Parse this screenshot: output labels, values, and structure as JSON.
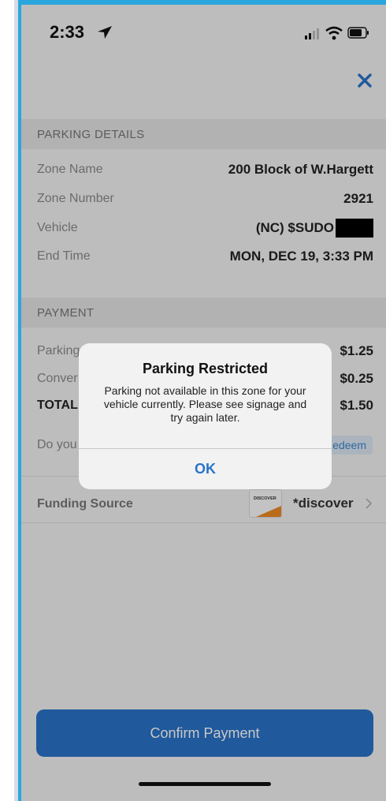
{
  "status_bar": {
    "time": "2:33",
    "icons": [
      "location-arrow-icon",
      "signal-icon",
      "wifi-icon",
      "battery-icon"
    ]
  },
  "header": {
    "close_icon": "close-icon"
  },
  "parking_details": {
    "title": "PARKING DETAILS",
    "zone_name_label": "Zone Name",
    "zone_name_value": "200 Block of W.Hargett",
    "zone_number_label": "Zone Number",
    "zone_number_value": "2921",
    "vehicle_label": "Vehicle",
    "vehicle_value": "(NC) $SUDO",
    "end_time_label": "End Time",
    "end_time_value": "MON, DEC 19, 3:33 PM"
  },
  "payment": {
    "title": "PAYMENT",
    "parking_label": "Parking",
    "parking_value": "$1.25",
    "convenience_label": "Conver",
    "convenience_value": "$0.25",
    "total_label": "TOTAL",
    "total_value": "$1.50",
    "promo_label": "Do you",
    "redeem_label": "edeem"
  },
  "funding": {
    "label": "Funding Source",
    "card_brand": "DISCOVER",
    "card_value": "*discover"
  },
  "confirm_label": "Confirm Payment",
  "alert": {
    "title": "Parking Restricted",
    "message": "Parking not available in this zone for your vehicle currently. Please see signage and try again later.",
    "ok_label": "OK"
  },
  "colors": {
    "accent_blue": "#2a73c8",
    "frame_blue": "#2aa6df",
    "discover_orange": "#f08a24"
  }
}
